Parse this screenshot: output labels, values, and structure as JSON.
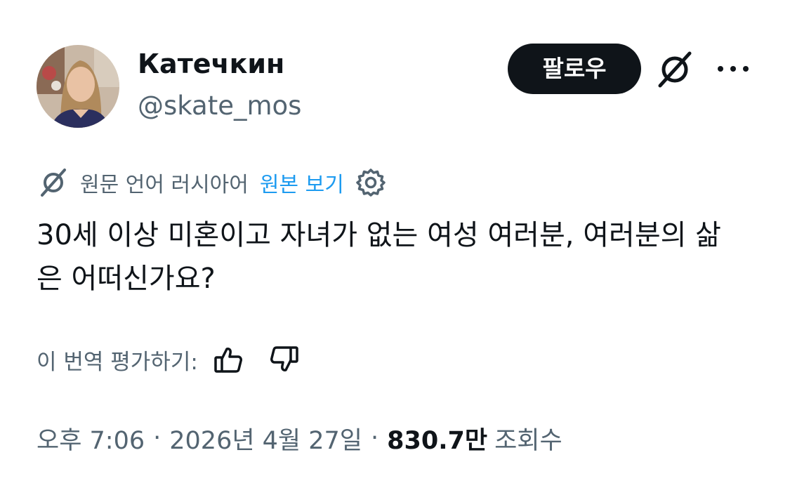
{
  "author": {
    "display_name": "Катечкин",
    "handle": "@skate_mos"
  },
  "actions": {
    "follow_label": "팔로우",
    "grok_icon": "grok-icon",
    "more_icon": "more-dots-icon"
  },
  "translation": {
    "source_label": "원문 언어 러시아어",
    "view_original": "원본 보기",
    "settings_icon": "gear-icon"
  },
  "tweet": {
    "text": "30세 이상 미혼이고 자녀가 없는 여성 여러분, 여러분의 삶은 어떠신가요?"
  },
  "rating": {
    "label": "이 번역 평가하기:",
    "like_icon": "thumbs-up-icon",
    "dislike_icon": "thumbs-down-icon"
  },
  "meta": {
    "time": "오후 7:06",
    "separator": "·",
    "date": "2026년 4월 27일",
    "views_count": "830.7만",
    "views_label": "조회수"
  },
  "colors": {
    "text_primary": "#0f1419",
    "text_secondary": "#536471",
    "link": "#1d9bf0",
    "button_bg": "#0f1419"
  }
}
